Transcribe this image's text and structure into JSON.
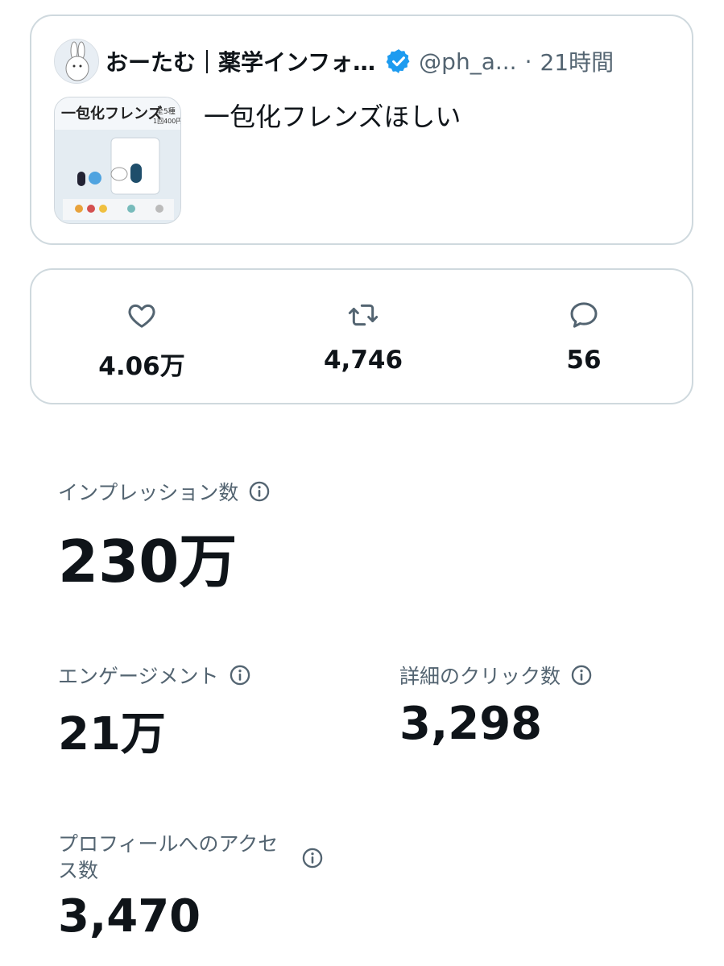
{
  "tweet": {
    "author_name": "おーたむ｜薬学インフォ…",
    "handle": "@ph_a...",
    "separator": "·",
    "time": "21時間",
    "text": "一包化フレンズほしい",
    "thumbnail": {
      "title": "一包化フレンズ",
      "badge": "全5種",
      "price": "1回400円"
    },
    "verified_color": "#1d9bf0"
  },
  "stats": {
    "likes": "4.06万",
    "retweets": "4,746",
    "replies": "56"
  },
  "metrics": {
    "impressions": {
      "label": "インプレッション数",
      "value": "230万"
    },
    "engagements": {
      "label": "エンゲージメント",
      "value": "21万"
    },
    "detail_clicks": {
      "label": "詳細のクリック数",
      "value": "3,298"
    },
    "profile_visits": {
      "label": "プロフィールへのアクセス数",
      "value": "3,470"
    }
  },
  "colors": {
    "border": "#cfd9de",
    "secondary_text": "#536471",
    "primary_text": "#0f1419"
  }
}
